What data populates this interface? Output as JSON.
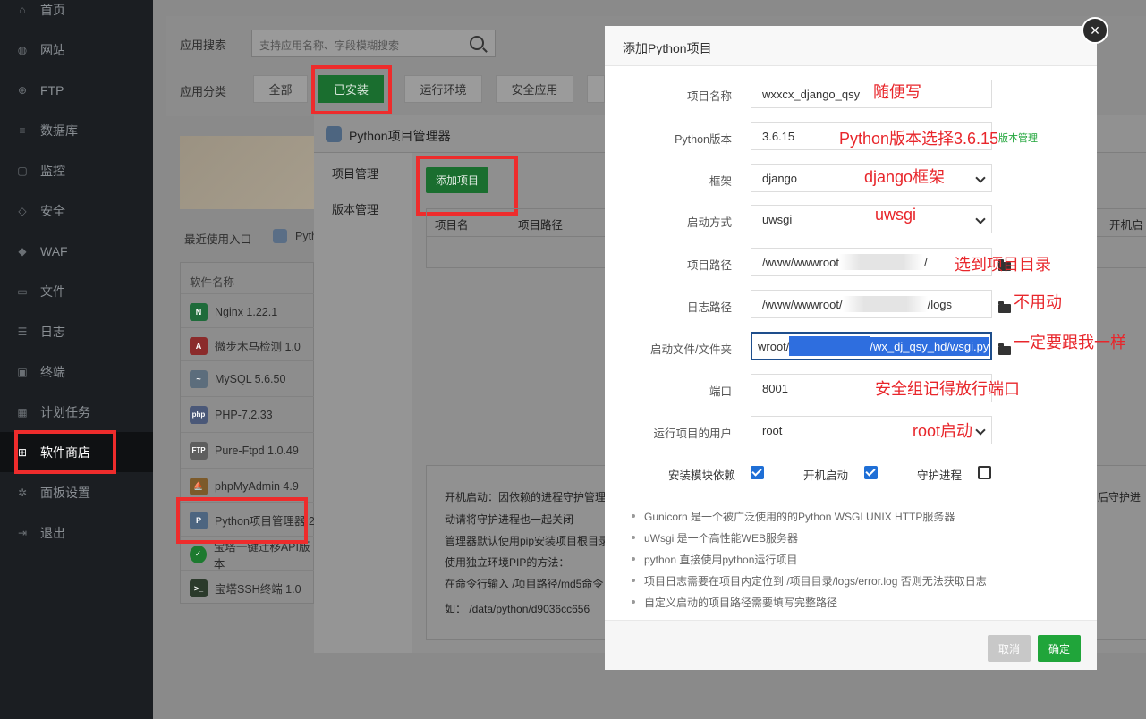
{
  "sidebar": {
    "items": [
      {
        "label": "首页",
        "icon": "home-icon"
      },
      {
        "label": "网站",
        "icon": "globe-icon"
      },
      {
        "label": "FTP",
        "icon": "ftp-icon"
      },
      {
        "label": "数据库",
        "icon": "database-icon"
      },
      {
        "label": "监控",
        "icon": "monitor-icon"
      },
      {
        "label": "安全",
        "icon": "shield-icon"
      },
      {
        "label": "WAF",
        "icon": "waf-shield-icon"
      },
      {
        "label": "文件",
        "icon": "folder-icon"
      },
      {
        "label": "日志",
        "icon": "log-icon"
      },
      {
        "label": "终端",
        "icon": "terminal-icon"
      },
      {
        "label": "计划任务",
        "icon": "calendar-icon"
      },
      {
        "label": "软件商店",
        "icon": "apps-grid-icon",
        "active": true
      },
      {
        "label": "面板设置",
        "icon": "gear-icon"
      },
      {
        "label": "退出",
        "icon": "logout-icon"
      }
    ]
  },
  "store": {
    "search_label": "应用搜索",
    "search_placeholder": "支持应用名称、字段模糊搜索",
    "category_label": "应用分类",
    "categories": [
      "全部",
      "已安装",
      "运行环境",
      "安全应用"
    ],
    "active_category": "已安装",
    "recent_label": "最近使用入口",
    "recent_app_partial": "Pyth",
    "list_header": "软件名称",
    "apps": [
      {
        "name": "Nginx 1.22.1",
        "icon": "nginx-icon"
      },
      {
        "name": "微步木马检测 1.0",
        "icon": "threat-scan-icon"
      },
      {
        "name": "MySQL 5.6.50",
        "icon": "mysql-icon"
      },
      {
        "name": "PHP-7.2.33",
        "icon": "php-icon"
      },
      {
        "name": "Pure-Ftpd 1.0.49",
        "icon": "ftp-app-icon"
      },
      {
        "name": "phpMyAdmin 4.9",
        "icon": "phpmyadmin-icon"
      },
      {
        "name": "Python项目管理器 2",
        "icon": "python-icon"
      },
      {
        "name": "宝塔一键迁移API版本",
        "icon": "migrate-icon"
      },
      {
        "name": "宝塔SSH终端 1.0",
        "icon": "ssh-terminal-icon"
      }
    ]
  },
  "python_manager": {
    "title": "Python项目管理器",
    "tabs": [
      "项目管理",
      "版本管理"
    ],
    "add_button": "添加项目",
    "table_headers": [
      "项目名",
      "项目路径",
      "开机启"
    ],
    "info_lines": [
      "开机启动：因依赖的进程守护管理",
      "动请将守护进程也一起关闭",
      "管理器默认使用pip安装项目根目录",
      "使用独立环境PIP的方法：",
      "在命令行输入  /项目路径/md5命令",
      "如：  /data/python/d9036cc656"
    ],
    "info_right_partial": "后守护进"
  },
  "dialog": {
    "title": "添加Python项目",
    "fields": {
      "name_label": "项目名称",
      "name_value": "wxxcx_django_qsy",
      "version_label": "Python版本",
      "version_value": "3.6.15",
      "version_link": "版本管理",
      "framework_label": "框架",
      "framework_value": "django",
      "startup_label": "启动方式",
      "startup_value": "uwsgi",
      "path_label": "项目路径",
      "path_value_start": "/www/wwwroot",
      "path_value_end": "/",
      "log_label": "日志路径",
      "log_value_start": "/www/wwwroot/",
      "log_value_end": "/logs",
      "entry_label": "启动文件/文件夹",
      "entry_value_start": "wroot/",
      "entry_value_end": "/wx_dj_qsy_hd/wsgi.py",
      "port_label": "端口",
      "port_value": "8001",
      "user_label": "运行项目的用户",
      "user_value": "root"
    },
    "checkboxes": [
      {
        "label": "安装模块依赖",
        "checked": true
      },
      {
        "label": "开机启动",
        "checked": true
      },
      {
        "label": "守护进程",
        "checked": false
      }
    ],
    "tips": [
      "Gunicorn 是一个被广泛使用的的Python WSGI UNIX HTTP服务器",
      "uWsgi 是一个高性能WEB服务器",
      "python 直接使用python运行项目",
      "项目日志需要在项目内定位到 /项目目录/logs/error.log 否则无法获取日志",
      "自定义启动的项目路径需要填写完整路径"
    ],
    "cancel": "取消",
    "confirm": "确定"
  },
  "annotations": {
    "name": "随便写",
    "version": "Python版本选择3.6.15",
    "framework": "django框架",
    "startup": "uwsgi",
    "path": "选到项目目录",
    "log": "不用动",
    "entry": "一定要跟我一样",
    "port": "安全组记得放行端口",
    "user": "root启动"
  },
  "colors": {
    "accent_green": "#20a53a",
    "annotation_red": "#e8262b",
    "sidebar_bg": "#1b1e22"
  }
}
